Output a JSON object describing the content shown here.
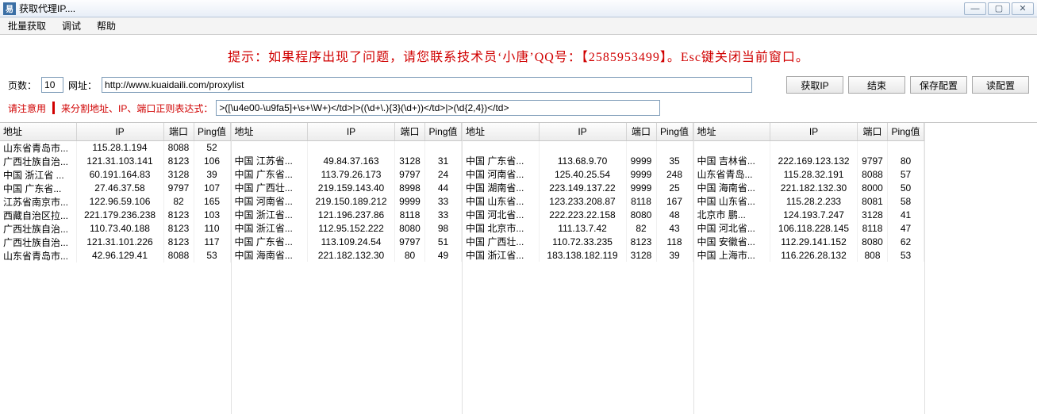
{
  "window": {
    "title": "获取代理IP...."
  },
  "menu": {
    "batch": "批量获取",
    "debug": "调试",
    "help": "帮助"
  },
  "hint": "提示：如果程序出现了问题，请您联系技术员‘小唐’QQ号：【2585953499】。Esc键关闭当前窗口。",
  "toolbar": {
    "pages_label": "页数：",
    "pages_value": "10",
    "url_label": "网址：",
    "url_value": "http://www.kuaidaili.com/proxylist",
    "btn_fetch": "获取IP",
    "btn_end": "结束",
    "btn_save": "保存配置",
    "btn_load": "读配置"
  },
  "regexrow": {
    "prefix": "请注意用",
    "red_text": "来分割地址、IP、端口正则表达式：",
    "regex_value": ">([\\u4e00-\\u9fa5]+\\s+\\W+)</td>|>((\\d+\\.){3}(\\d+))</td>|>(\\d{2,4})</td>"
  },
  "columns": {
    "addr": "地址",
    "ip": "IP",
    "port": "端口",
    "ping": "Ping值"
  },
  "tables": [
    [
      {
        "addr": "山东省青岛市...",
        "ip": "115.28.1.194",
        "port": "8088",
        "ping": "52"
      },
      {
        "addr": "广西壮族自治...",
        "ip": "121.31.103.141",
        "port": "8123",
        "ping": "106"
      },
      {
        "addr": "中国 浙江省 ...",
        "ip": "60.191.164.83",
        "port": "3128",
        "ping": "39"
      },
      {
        "addr": "中国 广东省...",
        "ip": "27.46.37.58",
        "port": "9797",
        "ping": "107"
      },
      {
        "addr": "江苏省南京市...",
        "ip": "122.96.59.106",
        "port": "82",
        "ping": "165"
      },
      {
        "addr": "西藏自治区拉...",
        "ip": "221.179.236.238",
        "port": "8123",
        "ping": "103"
      },
      {
        "addr": "广西壮族自治...",
        "ip": "110.73.40.188",
        "port": "8123",
        "ping": "110"
      },
      {
        "addr": "广西壮族自治...",
        "ip": "121.31.101.226",
        "port": "8123",
        "ping": "117"
      },
      {
        "addr": "山东省青岛市...",
        "ip": "42.96.129.41",
        "port": "8088",
        "ping": "53"
      }
    ],
    [
      {
        "addr": "中国 江苏省...",
        "ip": "49.84.37.163",
        "port": "3128",
        "ping": "31"
      },
      {
        "addr": "中国 广东省...",
        "ip": "113.79.26.173",
        "port": "9797",
        "ping": "24"
      },
      {
        "addr": "中国 广西壮...",
        "ip": "219.159.143.40",
        "port": "8998",
        "ping": "44"
      },
      {
        "addr": "中国 河南省...",
        "ip": "219.150.189.212",
        "port": "9999",
        "ping": "33"
      },
      {
        "addr": "中国 浙江省...",
        "ip": "121.196.237.86",
        "port": "8118",
        "ping": "33"
      },
      {
        "addr": "中国 浙江省...",
        "ip": "112.95.152.222",
        "port": "8080",
        "ping": "98"
      },
      {
        "addr": "中国 广东省...",
        "ip": "113.109.24.54",
        "port": "9797",
        "ping": "51"
      },
      {
        "addr": "中国 海南省...",
        "ip": "221.182.132.30",
        "port": "80",
        "ping": "49"
      }
    ],
    [
      {
        "addr": "中国 广东省...",
        "ip": "113.68.9.70",
        "port": "9999",
        "ping": "35"
      },
      {
        "addr": "中国 河南省...",
        "ip": "125.40.25.54",
        "port": "9999",
        "ping": "248"
      },
      {
        "addr": "中国 湖南省...",
        "ip": "223.149.137.22",
        "port": "9999",
        "ping": "25"
      },
      {
        "addr": "中国 山东省...",
        "ip": "123.233.208.87",
        "port": "8118",
        "ping": "167"
      },
      {
        "addr": "中国 河北省...",
        "ip": "222.223.22.158",
        "port": "8080",
        "ping": "48"
      },
      {
        "addr": "中国 北京市...",
        "ip": "111.13.7.42",
        "port": "82",
        "ping": "43"
      },
      {
        "addr": "中国 广西壮...",
        "ip": "110.72.33.235",
        "port": "8123",
        "ping": "118"
      },
      {
        "addr": "中国 浙江省...",
        "ip": "183.138.182.119",
        "port": "3128",
        "ping": "39"
      }
    ],
    [
      {
        "addr": "中国 吉林省...",
        "ip": "222.169.123.132",
        "port": "9797",
        "ping": "80"
      },
      {
        "addr": "山东省青岛...",
        "ip": "115.28.32.191",
        "port": "8088",
        "ping": "57"
      },
      {
        "addr": "中国 海南省...",
        "ip": "221.182.132.30",
        "port": "8000",
        "ping": "50"
      },
      {
        "addr": "中国 山东省...",
        "ip": "115.28.2.233",
        "port": "8081",
        "ping": "58"
      },
      {
        "addr": "北京市  鹏...",
        "ip": "124.193.7.247",
        "port": "3128",
        "ping": "41"
      },
      {
        "addr": "中国 河北省...",
        "ip": "106.118.228.145",
        "port": "8118",
        "ping": "47"
      },
      {
        "addr": "中国 安徽省...",
        "ip": "112.29.141.152",
        "port": "8080",
        "ping": "62"
      },
      {
        "addr": "中国 上海市...",
        "ip": "116.226.28.132",
        "port": "808",
        "ping": "53"
      }
    ]
  ]
}
